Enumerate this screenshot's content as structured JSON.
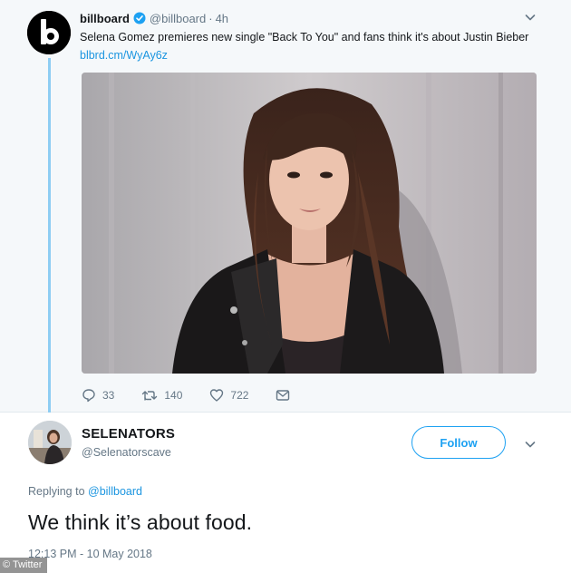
{
  "top_tweet": {
    "author_name": "billboard",
    "author_handle": "@billboard",
    "separator": "·",
    "time": "4h",
    "text": "Selena Gomez premieres new single \"Back To You\" and fans think it's about Justin Bieber ",
    "link": "blbrd.cm/WyAy6z",
    "avatar_icon": "billboard-logo-icon",
    "verified_icon": "verified-badge-icon",
    "actions": {
      "replies": "33",
      "retweets": "140",
      "likes": "722"
    }
  },
  "reply": {
    "author_name": "SELENATORS",
    "author_handle": "@Selenatorscave",
    "follow_label": "Follow",
    "replying_prefix": "Replying to ",
    "replying_to": "@billboard",
    "text": "We think it’s about food.",
    "timestamp": "12:13 PM - 10 May 2018"
  },
  "watermark": "© Twitter",
  "colors": {
    "accent": "#1da1f2",
    "link": "#1b95e0",
    "muted": "#657786",
    "thread_line": "#8ecdf3",
    "tweet_bg": "#f5f8fa"
  }
}
